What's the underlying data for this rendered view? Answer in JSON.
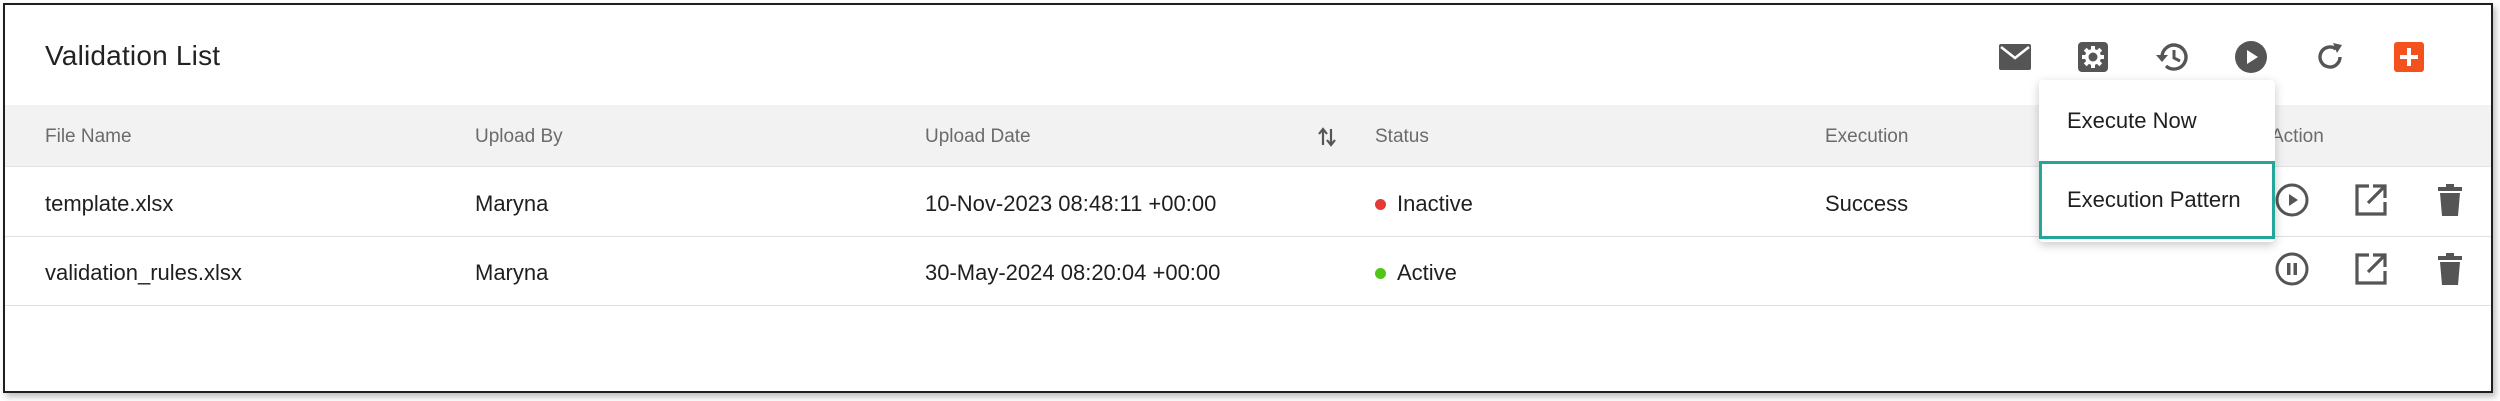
{
  "page": {
    "title": "Validation List"
  },
  "toolbar": {
    "buttons": [
      {
        "name": "mail-icon",
        "color": "#555555"
      },
      {
        "name": "gear-icon",
        "color": "#555555"
      },
      {
        "name": "history-icon",
        "color": "#555555"
      },
      {
        "name": "play-circle-icon",
        "color": "#555555"
      },
      {
        "name": "refresh-icon",
        "color": "#555555"
      },
      {
        "name": "add-icon",
        "color": "#f4511e"
      }
    ]
  },
  "table": {
    "columns": [
      "File Name",
      "Upload By",
      "Upload Date",
      "Status",
      "Execution",
      "Action"
    ],
    "rows": [
      {
        "file_name": "template.xlsx",
        "upload_by": "Maryna",
        "upload_date": "10-Nov-2023 08:48:11 +00:00",
        "status": "Inactive",
        "status_color": "#e53935",
        "execution": "Success",
        "run_action_icon": "play-circle-icon"
      },
      {
        "file_name": "validation_rules.xlsx",
        "upload_by": "Maryna",
        "upload_date": "30-May-2024 08:20:04 +00:00",
        "status": "Active",
        "status_color": "#52c41a",
        "execution": "",
        "run_action_icon": "pause-circle-icon"
      }
    ]
  },
  "dropdown": {
    "items": [
      "Execute Now",
      "Execution Pattern"
    ],
    "focused_index": 1,
    "focus_color": "#26a69a"
  }
}
